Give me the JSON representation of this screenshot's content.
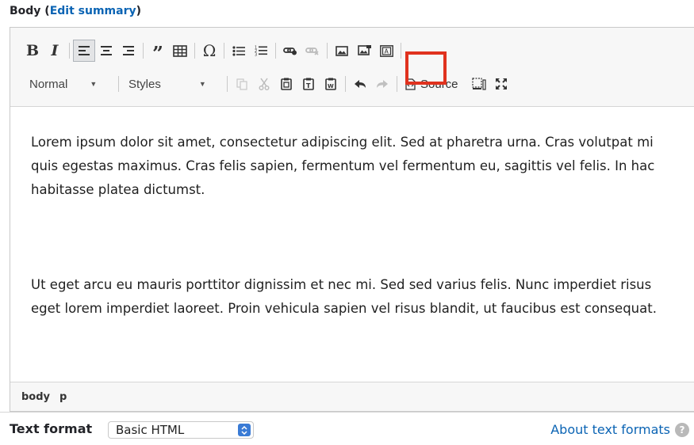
{
  "field": {
    "label": "Body",
    "edit_summary": "Edit summary"
  },
  "toolbar": {
    "row1": [
      "Bold",
      "Italic",
      "Align left",
      "Align center",
      "Align right",
      "Blockquote",
      "Table",
      "Special character",
      "Bulleted list",
      "Numbered list",
      "Link",
      "Unlink",
      "Image",
      "Image 2",
      "Template"
    ],
    "format_value": "Normal",
    "styles_value": "Styles",
    "source_label": "Source"
  },
  "content": {
    "paragraphs": [
      "Lorem ipsum dolor sit amet, consectetur adipiscing elit. Sed at pharetra urna. Cras volutpat mi quis egestas maximus. Cras felis sapien, fermentum vel fermentum eu, sagittis vel felis. In hac habitasse platea dictumst.",
      "Ut eget arcu eu mauris porttitor dignissim et nec mi. Sed sed varius felis. Nunc imperdiet risus eget lorem imperdiet laoreet. Proin vehicula sapien vel risus blandit, ut faucibus est consequat."
    ]
  },
  "statusbar": {
    "path": [
      "body",
      "p"
    ]
  },
  "text_format": {
    "label": "Text format",
    "selected": "Basic HTML",
    "about_link": "About text formats"
  },
  "colors": {
    "link": "#0b64b4",
    "highlight": "#e0321e",
    "toolbar_bg": "#f7f7f7"
  }
}
